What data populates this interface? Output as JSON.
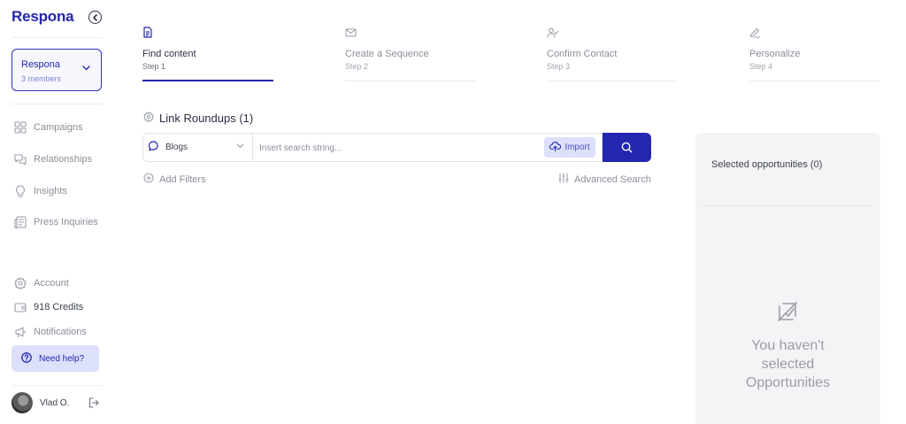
{
  "sidebar": {
    "logo": "Respona",
    "team": {
      "name": "Respona",
      "members": "3 members"
    },
    "nav": [
      {
        "label": "Campaigns",
        "icon": "grid-icon"
      },
      {
        "label": "Relationships",
        "icon": "chat-icon"
      },
      {
        "label": "Insights",
        "icon": "bulb-icon"
      },
      {
        "label": "Press Inquiries",
        "icon": "newspaper-icon"
      }
    ],
    "bottom_nav": [
      {
        "label": "Account",
        "icon": "gear-icon"
      },
      {
        "label": "918 Credits",
        "icon": "wallet-icon"
      },
      {
        "label": "Notifications",
        "icon": "megaphone-icon"
      }
    ],
    "help_label": "Need help?",
    "user_name": "Vlad O."
  },
  "steps": [
    {
      "title": "Find content",
      "sub": "Step 1",
      "active": true
    },
    {
      "title": "Create a Sequence",
      "sub": "Step 2",
      "active": false
    },
    {
      "title": "Confirm Contact",
      "sub": "Step 3",
      "active": false
    },
    {
      "title": "Personalize",
      "sub": "Step 4",
      "active": false
    }
  ],
  "main": {
    "section_title": "Link Roundups (1)",
    "source_select": "Blogs",
    "search_placeholder": "Insert search string...",
    "import_label": "Import",
    "add_filters": "Add Filters",
    "advanced_search": "Advanced Search"
  },
  "panel": {
    "title": "Selected opportunities (0)",
    "empty_text": "You haven't\nselected\nOpportunities"
  },
  "colors": {
    "accent": "#2327b0",
    "accent_light": "#dde0fb"
  }
}
